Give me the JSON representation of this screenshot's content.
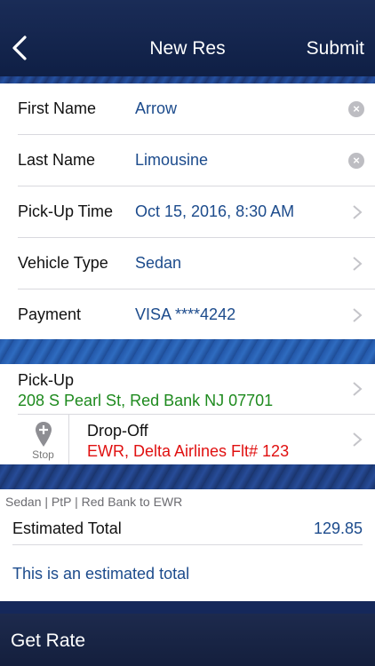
{
  "nav": {
    "title": "New Res",
    "submit_label": "Submit"
  },
  "form": {
    "rows": [
      {
        "label": "First Name",
        "value": "Arrow"
      },
      {
        "label": "Last Name",
        "value": "Limousine"
      },
      {
        "label": "Pick-Up Time",
        "value": "Oct 15, 2016, 8:30 AM"
      },
      {
        "label": "Vehicle Type",
        "value": "Sedan"
      },
      {
        "label": "Payment",
        "value": "VISA ****4242"
      }
    ]
  },
  "locations": {
    "pickup": {
      "label": "Pick-Up",
      "address": "208 S Pearl St, Red Bank NJ 07701"
    },
    "stop": {
      "label": "Stop"
    },
    "dropoff": {
      "label": "Drop-Off",
      "address": "EWR, Delta Airlines Flt# 123"
    }
  },
  "estimate": {
    "summary": "Sedan | PtP | Red Bank to EWR",
    "total_label": "Estimated Total",
    "total_value": "129.85",
    "note": "This is an estimated total"
  },
  "bottom": {
    "get_rate_label": "Get Rate"
  },
  "colors": {
    "nav_bg": "#0f1f45",
    "value_blue": "#1c4b8c",
    "pickup_green": "#1e8a1e",
    "dropoff_red": "#e01010"
  }
}
